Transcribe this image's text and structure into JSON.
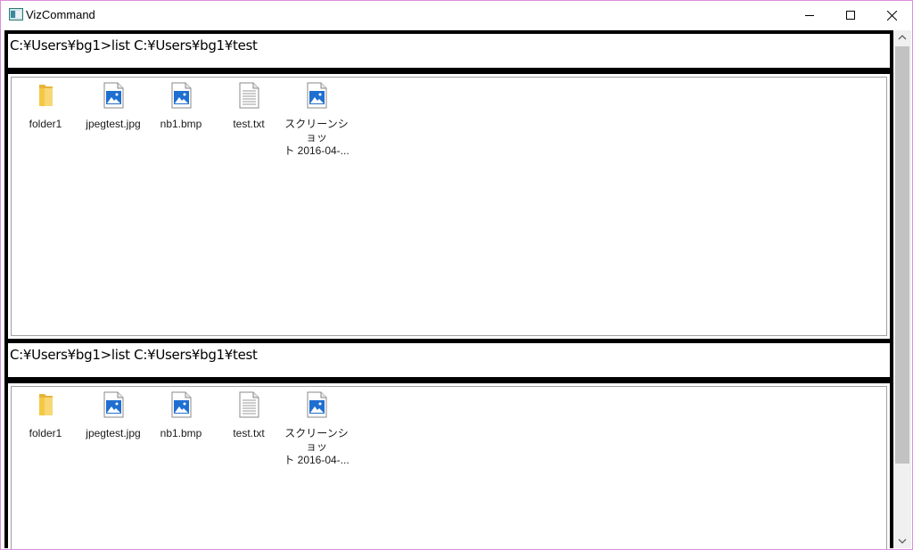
{
  "window": {
    "title": "VizCommand"
  },
  "sessions": [
    {
      "command": "C:¥Users¥bg1>list C:¥Users¥bg1¥test",
      "files": [
        {
          "name": "folder1",
          "icon": "folder-icon"
        },
        {
          "name": "jpegtest.jpg",
          "icon": "image-file-icon"
        },
        {
          "name": "nb1.bmp",
          "icon": "image-file-icon"
        },
        {
          "name": "test.txt",
          "icon": "text-file-icon"
        },
        {
          "name_line1": "スクリーンショッ",
          "name_line2": "ト 2016-04-...",
          "icon": "image-file-icon"
        }
      ]
    },
    {
      "command": "C:¥Users¥bg1>list C:¥Users¥bg1¥test",
      "files": [
        {
          "name": "folder1",
          "icon": "folder-icon"
        },
        {
          "name": "jpegtest.jpg",
          "icon": "image-file-icon"
        },
        {
          "name": "nb1.bmp",
          "icon": "image-file-icon"
        },
        {
          "name": "test.txt",
          "icon": "text-file-icon"
        },
        {
          "name_line1": "スクリーンショッ",
          "name_line2": "ト 2016-04-...",
          "icon": "image-file-icon"
        }
      ]
    }
  ],
  "colors": {
    "window_border": "#d98fd9",
    "panel_border": "#a0a0a0",
    "folder": "#f5c842",
    "image_blue": "#1f6fd1"
  }
}
